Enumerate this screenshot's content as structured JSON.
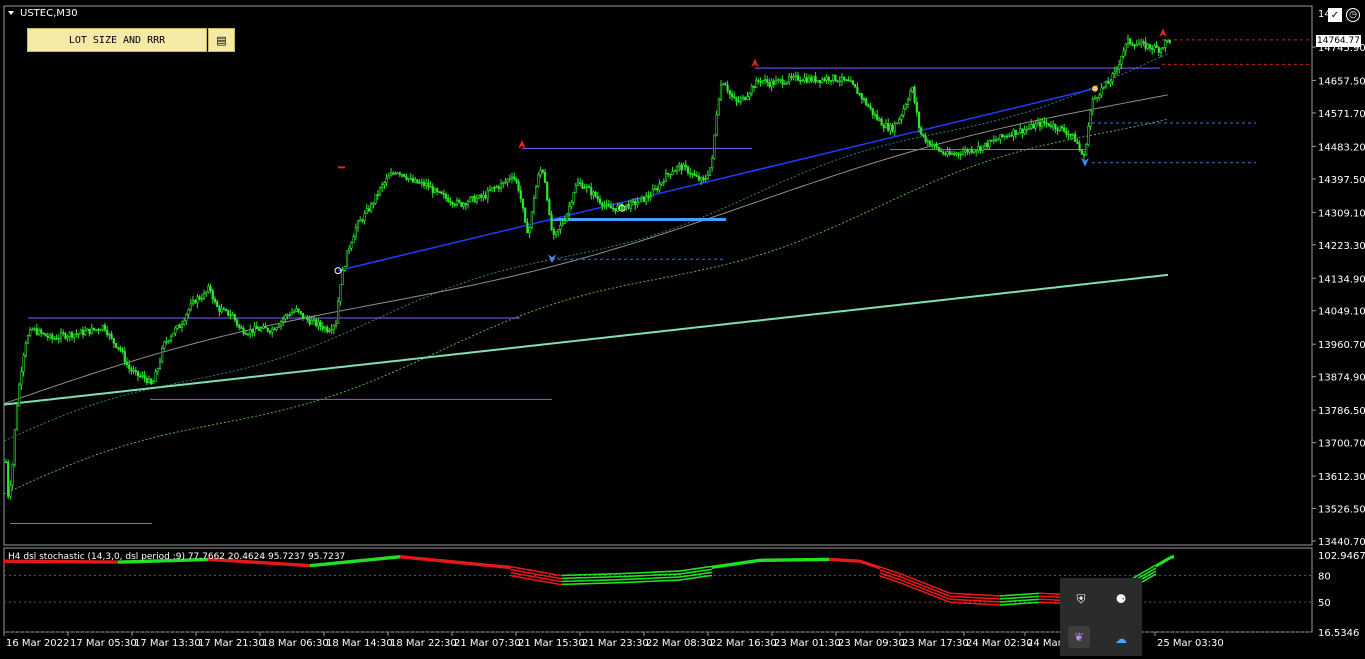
{
  "symbol_title": "USTEC,M30",
  "lot_button_label": "LOT SIZE AND RRR",
  "lot_button_icon": "calculator-icon",
  "top_right_price_partial": "14",
  "price_tag": "14764.77",
  "indicator_title": "H4 dsl stochastic (14,3,0, dsl period :9) 77.7662 20.4624 95.7237 95.7237",
  "chart_data": {
    "type": "candlestick",
    "title": "USTEC,M30",
    "price_axis": {
      "ticks": [
        14745.9,
        14657.5,
        14571.7,
        14483.2,
        14397.5,
        14309.1,
        14223.3,
        14134.9,
        14049.1,
        13960.7,
        13874.9,
        13786.5,
        13700.7,
        13612.3,
        13526.5,
        13440.7
      ],
      "range": [
        13440.7,
        14800
      ]
    },
    "time_axis": {
      "labels": [
        "16 Mar 2022",
        "17 Mar 05:30",
        "17 Mar 13:30",
        "17 Mar 21:30",
        "18 Mar 06:30",
        "18 Mar 14:30",
        "18 Mar 22:30",
        "21 Mar 07:30",
        "21 Mar 15:30",
        "21 Mar 23:30",
        "22 Mar 08:30",
        "22 Mar 16:30",
        "23 Mar 01:30",
        "23 Mar 09:30",
        "23 Mar 17:30",
        "24 Mar 02:30",
        "24 Mar",
        "25 Mar 03:30"
      ]
    },
    "price_path": [
      [
        0,
        13800
      ],
      [
        4,
        13740
      ],
      [
        8,
        13560
      ],
      [
        12,
        13620
      ],
      [
        16,
        13780
      ],
      [
        20,
        13870
      ],
      [
        25,
        13965
      ],
      [
        32,
        14000
      ],
      [
        40,
        13990
      ],
      [
        52,
        13975
      ],
      [
        64,
        13985
      ],
      [
        80,
        13990
      ],
      [
        96,
        14000
      ],
      [
        104,
        14010
      ],
      [
        112,
        13970
      ],
      [
        120,
        13950
      ],
      [
        128,
        13900
      ],
      [
        136,
        13880
      ],
      [
        146,
        13870
      ],
      [
        152,
        13850
      ],
      [
        158,
        13900
      ],
      [
        164,
        13960
      ],
      [
        172,
        13990
      ],
      [
        180,
        14010
      ],
      [
        188,
        14050
      ],
      [
        196,
        14080
      ],
      [
        204,
        14090
      ],
      [
        210,
        14110
      ],
      [
        216,
        14060
      ],
      [
        224,
        14045
      ],
      [
        232,
        14040
      ],
      [
        240,
        14000
      ],
      [
        248,
        13995
      ],
      [
        256,
        14000
      ],
      [
        264,
        14000
      ],
      [
        272,
        14000
      ],
      [
        280,
        14020
      ],
      [
        288,
        14040
      ],
      [
        296,
        14050
      ],
      [
        304,
        14030
      ],
      [
        312,
        14020
      ],
      [
        320,
        14010
      ],
      [
        328,
        14000
      ],
      [
        336,
        14020
      ],
      [
        340,
        14120
      ],
      [
        348,
        14210
      ],
      [
        356,
        14270
      ],
      [
        364,
        14300
      ],
      [
        372,
        14330
      ],
      [
        380,
        14370
      ],
      [
        388,
        14400
      ],
      [
        396,
        14420
      ],
      [
        404,
        14410
      ],
      [
        412,
        14390
      ],
      [
        420,
        14385
      ],
      [
        428,
        14380
      ],
      [
        436,
        14360
      ],
      [
        444,
        14350
      ],
      [
        452,
        14340
      ],
      [
        460,
        14330
      ],
      [
        468,
        14340
      ],
      [
        476,
        14345
      ],
      [
        484,
        14350
      ],
      [
        492,
        14370
      ],
      [
        500,
        14380
      ],
      [
        506,
        14390
      ],
      [
        512,
        14410
      ],
      [
        518,
        14380
      ],
      [
        522,
        14330
      ],
      [
        526,
        14260
      ],
      [
        530,
        14270
      ],
      [
        534,
        14350
      ],
      [
        538,
        14400
      ],
      [
        542,
        14430
      ],
      [
        546,
        14380
      ],
      [
        550,
        14280
      ],
      [
        554,
        14240
      ],
      [
        558,
        14260
      ],
      [
        562,
        14280
      ],
      [
        566,
        14300
      ],
      [
        570,
        14330
      ],
      [
        574,
        14370
      ],
      [
        578,
        14385
      ],
      [
        584,
        14380
      ],
      [
        592,
        14360
      ],
      [
        600,
        14340
      ],
      [
        608,
        14320
      ],
      [
        616,
        14320
      ],
      [
        624,
        14325
      ],
      [
        632,
        14330
      ],
      [
        640,
        14340
      ],
      [
        648,
        14350
      ],
      [
        656,
        14370
      ],
      [
        664,
        14400
      ],
      [
        672,
        14420
      ],
      [
        680,
        14430
      ],
      [
        688,
        14420
      ],
      [
        696,
        14400
      ],
      [
        704,
        14390
      ],
      [
        712,
        14440
      ],
      [
        716,
        14560
      ],
      [
        720,
        14640
      ],
      [
        724,
        14660
      ],
      [
        730,
        14620
      ],
      [
        736,
        14600
      ],
      [
        744,
        14610
      ],
      [
        752,
        14640
      ],
      [
        760,
        14660
      ],
      [
        770,
        14650
      ],
      [
        780,
        14655
      ],
      [
        790,
        14660
      ],
      [
        800,
        14665
      ],
      [
        810,
        14660
      ],
      [
        820,
        14660
      ],
      [
        830,
        14665
      ],
      [
        840,
        14660
      ],
      [
        850,
        14650
      ],
      [
        860,
        14620
      ],
      [
        868,
        14590
      ],
      [
        876,
        14560
      ],
      [
        884,
        14540
      ],
      [
        892,
        14530
      ],
      [
        900,
        14560
      ],
      [
        906,
        14600
      ],
      [
        912,
        14640
      ],
      [
        916,
        14580
      ],
      [
        920,
        14520
      ],
      [
        926,
        14500
      ],
      [
        932,
        14490
      ],
      [
        940,
        14470
      ],
      [
        948,
        14460
      ],
      [
        956,
        14465
      ],
      [
        964,
        14470
      ],
      [
        972,
        14475
      ],
      [
        980,
        14480
      ],
      [
        988,
        14490
      ],
      [
        996,
        14500
      ],
      [
        1004,
        14510
      ],
      [
        1012,
        14520
      ],
      [
        1020,
        14525
      ],
      [
        1028,
        14530
      ],
      [
        1036,
        14540
      ],
      [
        1044,
        14545
      ],
      [
        1052,
        14540
      ],
      [
        1060,
        14530
      ],
      [
        1068,
        14520
      ],
      [
        1076,
        14500
      ],
      [
        1080,
        14470
      ],
      [
        1084,
        14455
      ],
      [
        1088,
        14530
      ],
      [
        1092,
        14600
      ],
      [
        1100,
        14630
      ],
      [
        1108,
        14650
      ],
      [
        1116,
        14680
      ],
      [
        1122,
        14730
      ],
      [
        1128,
        14760
      ],
      [
        1136,
        14755
      ],
      [
        1144,
        14750
      ],
      [
        1152,
        14745
      ],
      [
        1160,
        14740
      ],
      [
        1166,
        14760
      ],
      [
        1172,
        14765
      ]
    ],
    "h_levels": [
      {
        "price": 14764.77,
        "style": "dashed",
        "color": "#d21f1f"
      },
      {
        "price": 14700,
        "style": "dashed",
        "color": "#d21f1f"
      },
      {
        "price": 14545,
        "style": "dashed",
        "color": "#3a6fd8"
      },
      {
        "price": 14440,
        "style": "dashed",
        "color": "#3a6fd8"
      },
      {
        "price": 14185,
        "style": "dashed",
        "color": "#3a6fd8"
      }
    ],
    "indicator": {
      "levels": [
        80,
        50,
        16.5346
      ],
      "top_label": "102.9467",
      "axis_labels": [
        "102.9467",
        "80",
        "50",
        "16.5346"
      ]
    }
  },
  "tray": {
    "icons": [
      "shield-check-icon",
      "audio-icon",
      "feather-app-icon",
      "cloud-icon"
    ]
  }
}
